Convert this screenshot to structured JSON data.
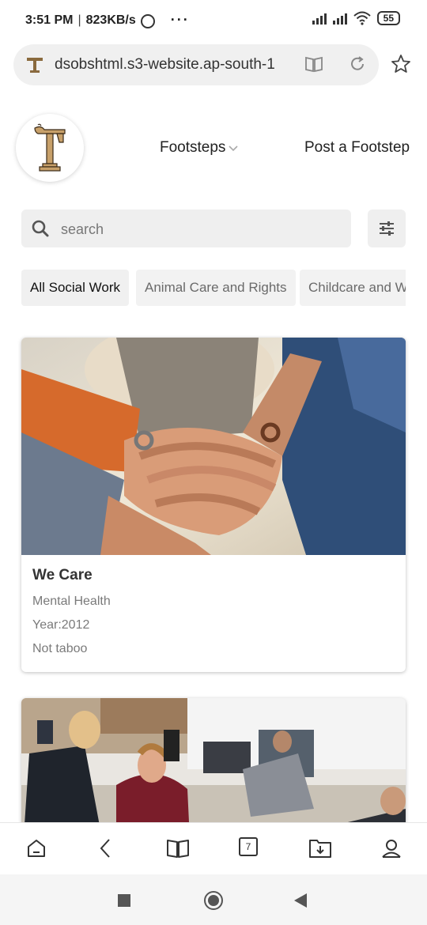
{
  "status_bar": {
    "time": "3:51 PM",
    "speed": "823KB/s",
    "more": "···",
    "battery": "55"
  },
  "browser": {
    "url": "dsobshtml.s3-website.ap-south-1",
    "tab_count": "7"
  },
  "nav": {
    "footsteps_label": "Footsteps",
    "post_label": "Post a Footstep"
  },
  "search": {
    "placeholder": "search",
    "value": ""
  },
  "categories": [
    {
      "label": "All Social Work",
      "active": true
    },
    {
      "label": "Animal Care and Rights",
      "active": false
    },
    {
      "label": "Childcare and Welfare",
      "active": false
    }
  ],
  "cards": [
    {
      "title": "We Care",
      "category": "Mental Health",
      "year": "Year:2012",
      "tagline": "Not taboo"
    }
  ],
  "colors": {
    "accent_logo": "#8a6a3e",
    "chip_bg": "#f2f2f2",
    "search_bg": "#efefef"
  }
}
